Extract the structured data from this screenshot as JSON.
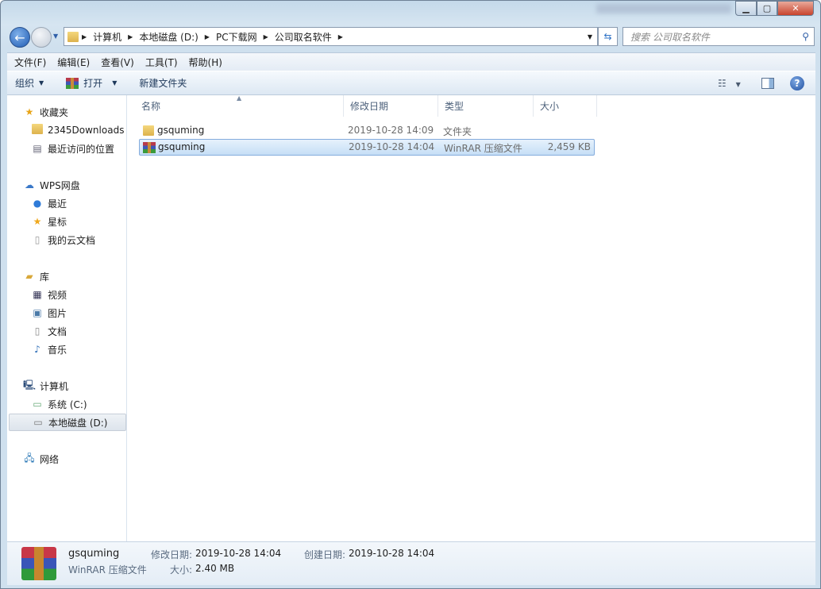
{
  "window": {
    "minimize_icon": "minimize-icon",
    "maximize_icon": "maximize-icon",
    "close_icon": "close-icon"
  },
  "address": {
    "crumbs": [
      "计算机",
      "本地磁盘 (D:)",
      "PC下载网",
      "公司取名软件"
    ]
  },
  "search": {
    "placeholder": "搜索 公司取名软件"
  },
  "menu": [
    "文件(F)",
    "编辑(E)",
    "查看(V)",
    "工具(T)",
    "帮助(H)"
  ],
  "toolbar": {
    "organize": "组织",
    "open": "打开",
    "new_folder": "新建文件夹"
  },
  "sidebar": {
    "favorites": {
      "label": "收藏夹",
      "items": [
        "2345Downloads",
        "最近访问的位置"
      ]
    },
    "wps": {
      "label": "WPS网盘",
      "items": [
        "最近",
        "星标",
        "我的云文档"
      ]
    },
    "library": {
      "label": "库",
      "items": [
        "视频",
        "图片",
        "文档",
        "音乐"
      ]
    },
    "computer": {
      "label": "计算机",
      "items": [
        "系统 (C:)",
        "本地磁盘 (D:)"
      ]
    },
    "network": {
      "label": "网络"
    }
  },
  "columns": [
    "名称",
    "修改日期",
    "类型",
    "大小"
  ],
  "files": [
    {
      "name": "gsquming",
      "date": "2019-10-28 14:09",
      "type": "文件夹",
      "size": ""
    },
    {
      "name": "gsquming",
      "date": "2019-10-28 14:04",
      "type": "WinRAR 压缩文件",
      "size": "2,459 KB"
    }
  ],
  "details": {
    "name": "gsquming",
    "type": "WinRAR 压缩文件",
    "modified_label": "修改日期:",
    "modified": "2019-10-28 14:04",
    "created_label": "创建日期:",
    "created": "2019-10-28 14:04",
    "size_label": "大小:",
    "size": "2.40 MB"
  }
}
